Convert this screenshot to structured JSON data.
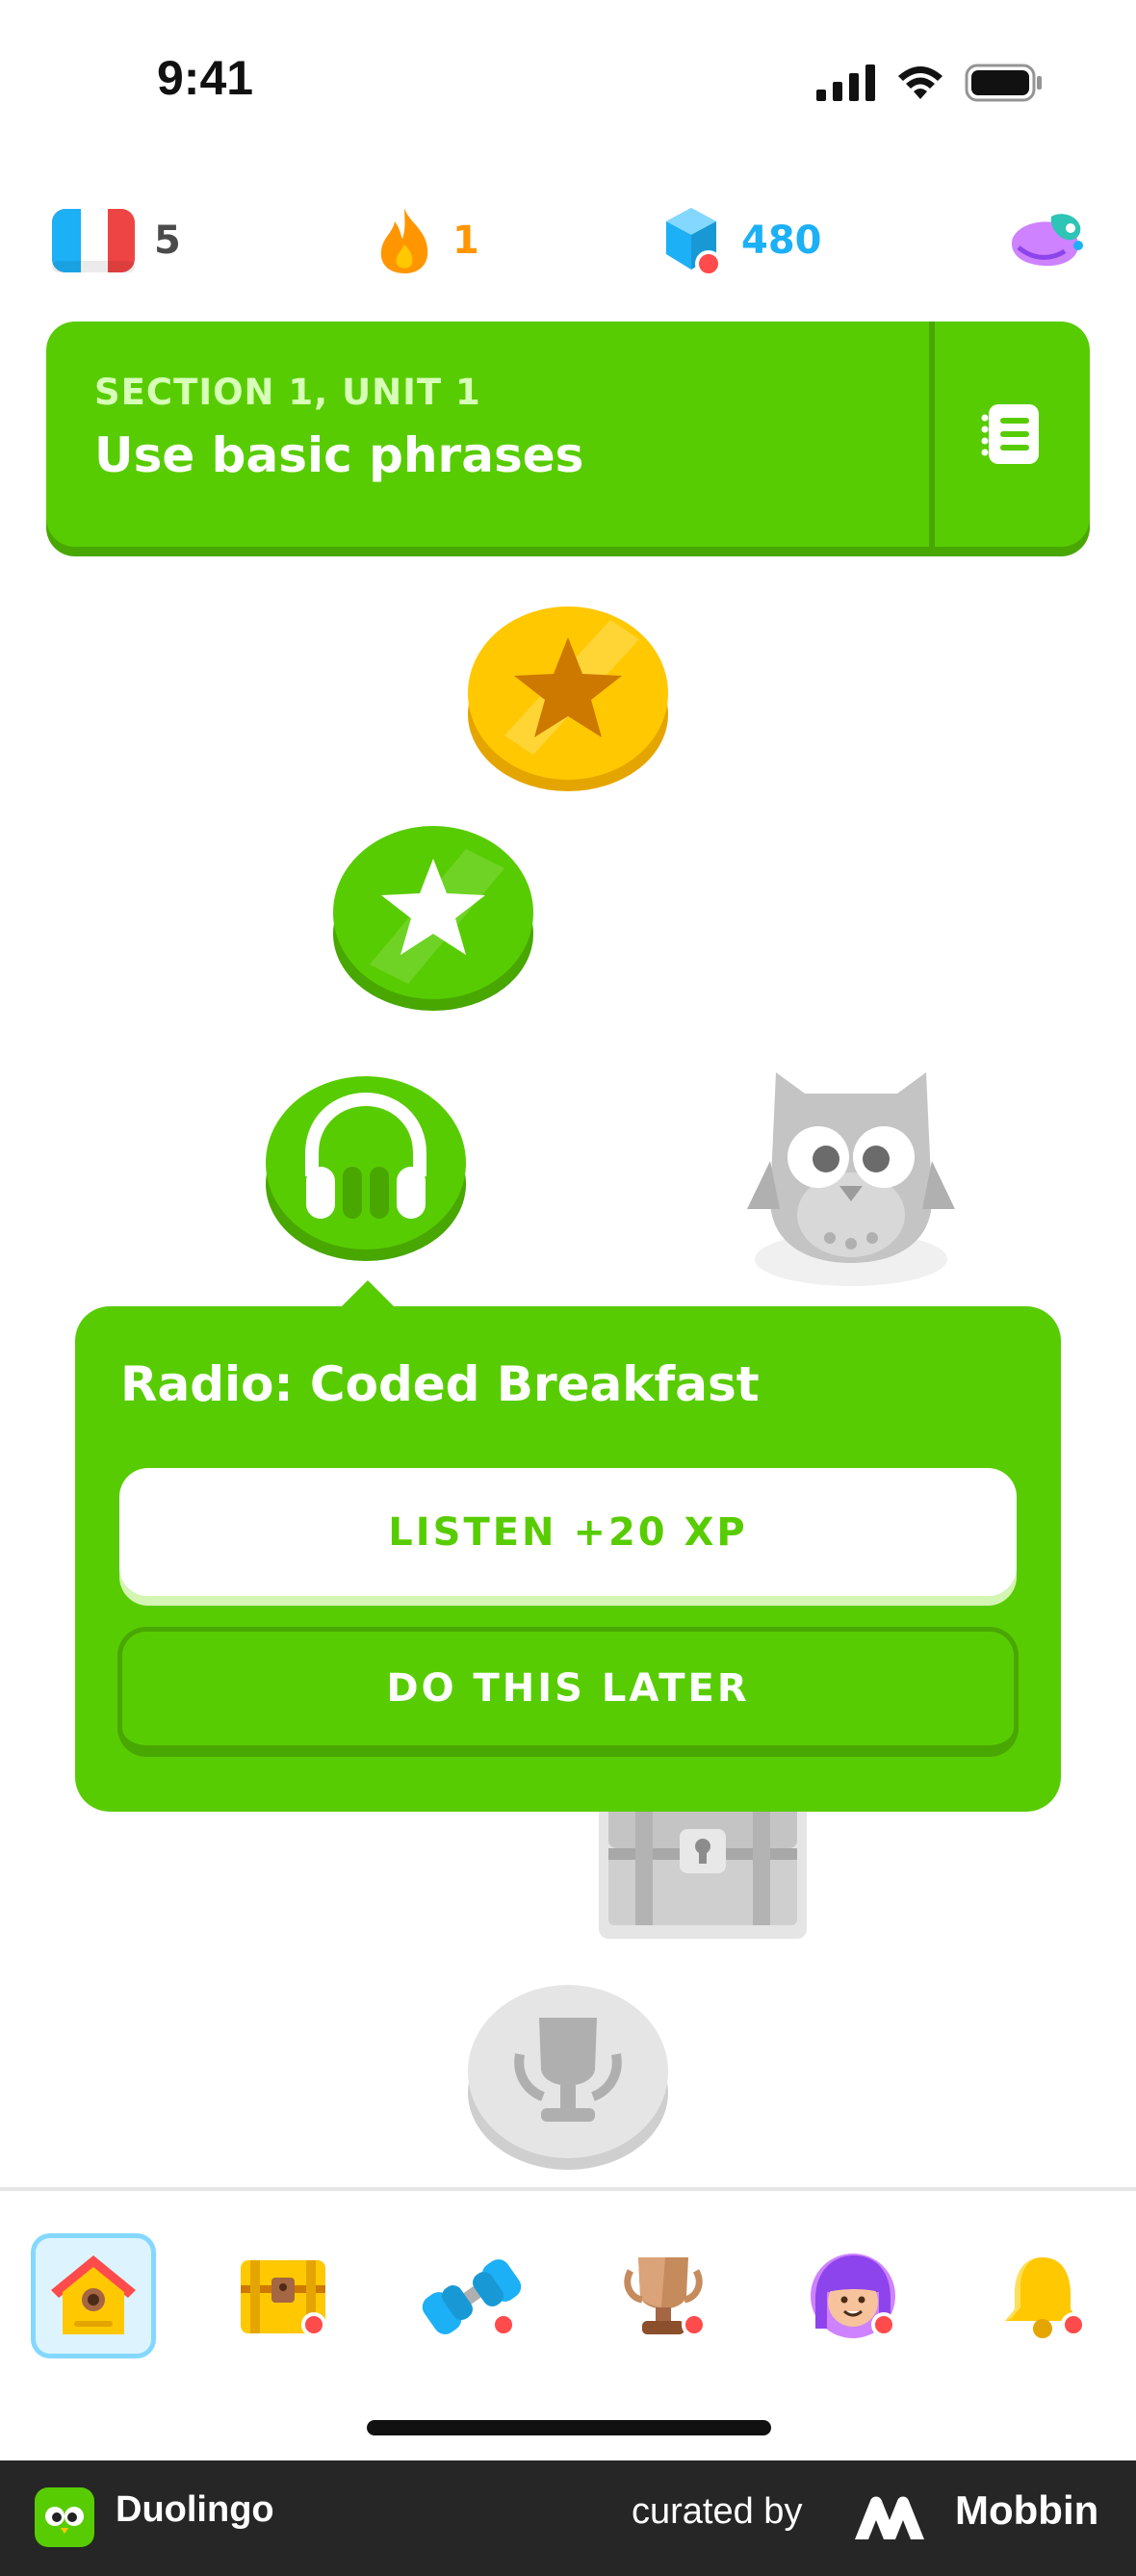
{
  "status_bar": {
    "time": "9:41"
  },
  "stats": {
    "language_flag": "flag-france-icon",
    "language_value": "5",
    "streak_value": "1",
    "gems_value": "480",
    "streak_color": "#ff9600",
    "gems_color": "#1cb0f6"
  },
  "unit": {
    "section": "SECTION 1, UNIT 1",
    "title": "Use basic phrases",
    "color": "#58cc02"
  },
  "path_nodes": [
    {
      "type": "gold-star-icon",
      "state": "completed"
    },
    {
      "type": "star-icon",
      "state": "completed"
    },
    {
      "type": "headphones-icon",
      "state": "active"
    },
    {
      "type": "chest-icon",
      "state": "locked"
    },
    {
      "type": "trophy-icon",
      "state": "locked"
    }
  ],
  "popover": {
    "title": "Radio: Coded Breakfast",
    "primary_label": "LISTEN +20 XP",
    "secondary_label": "DO THIS LATER"
  },
  "tabs": [
    {
      "name": "home",
      "icon": "home-icon",
      "active": true
    },
    {
      "name": "chest",
      "icon": "chest-icon",
      "badge": true
    },
    {
      "name": "practice",
      "icon": "dumbbell-icon",
      "badge": true
    },
    {
      "name": "leaderboards",
      "icon": "trophy-icon",
      "badge": true
    },
    {
      "name": "profile",
      "icon": "avatar-icon",
      "badge": true
    },
    {
      "name": "notifications",
      "icon": "bell-icon",
      "badge": true
    }
  ],
  "footer": {
    "app_name": "Duolingo",
    "curated_by": "curated by",
    "brand": "Mobbin"
  }
}
